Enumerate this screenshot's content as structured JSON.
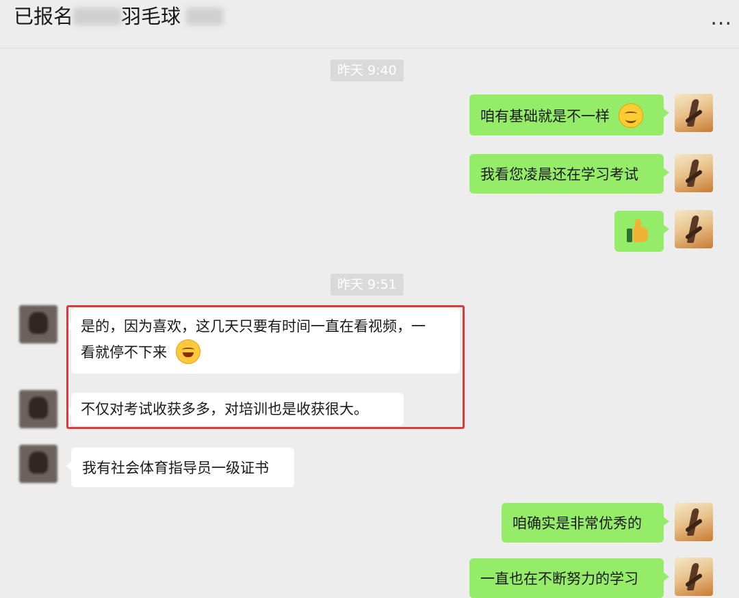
{
  "header": {
    "title_start": "已报名",
    "title_end": "羽毛球",
    "more_label": "..."
  },
  "messages": [
    {
      "type": "time",
      "text": "昨天 9:40"
    },
    {
      "type": "out",
      "text": "咱有基础就是不一样",
      "emoji": "smile-emoji"
    },
    {
      "type": "out",
      "text": "我看您凌晨还在学习考试"
    },
    {
      "type": "out",
      "sticker": "thumbs-up-icon"
    },
    {
      "type": "time",
      "text": "昨天 9:51"
    },
    {
      "type": "in",
      "line1": "是的，因为喜欢，这几天只要有时间一直在看视频，一",
      "line2": "看就停不下来",
      "emoji": "laughing-emoji"
    },
    {
      "type": "in",
      "text": "不仅对考试收获多多，对培训也是收获很大。"
    },
    {
      "type": "in",
      "text": "我有社会体育指导员一级证书"
    },
    {
      "type": "out",
      "text": "咱确实是非常优秀的"
    },
    {
      "type": "out",
      "text": "一直也在不断努力的学习"
    }
  ],
  "colors": {
    "outgoing_bubble": "#95ec69",
    "incoming_bubble": "#ffffff",
    "background": "#ededed",
    "highlight_border": "#d73b3b"
  }
}
